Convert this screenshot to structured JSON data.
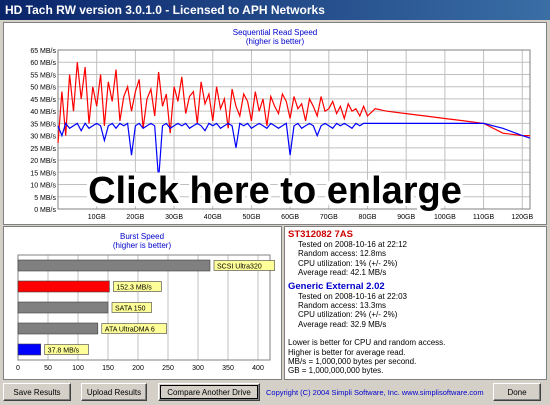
{
  "window": {
    "title": "HD Tach RW version 3.0.1.0 - Licensed to APH Networks"
  },
  "overlay_text": "Click here to enlarge",
  "colors": {
    "drive1": "#ff0000",
    "drive2": "#0000ff",
    "panel": "#d4d0c8"
  },
  "chart_data": [
    {
      "type": "line",
      "title": "Sequential Read Speed",
      "subtitle": "(higher is better)",
      "ylabel": "MB/s",
      "ylim": [
        0,
        65
      ],
      "y_ticks": [
        "0 MB/s",
        "5 MB/s",
        "10 MB/s",
        "15 MB/s",
        "20 MB/s",
        "25 MB/s",
        "30 MB/s",
        "35 MB/s",
        "40 MB/s",
        "45 MB/s",
        "50 MB/s",
        "55 MB/s",
        "60 MB/s",
        "65 MB/s"
      ],
      "xlim": [
        0,
        122
      ],
      "x_ticks": [
        "10GB",
        "20GB",
        "30GB",
        "40GB",
        "50GB",
        "60GB",
        "70GB",
        "80GB",
        "90GB",
        "100GB",
        "110GB",
        "120GB"
      ],
      "grid": true,
      "series": [
        {
          "name": "ST312082 7AS",
          "x": [
            0,
            1,
            2,
            3,
            4,
            5,
            6,
            7,
            8,
            9,
            10,
            11,
            12,
            13,
            14,
            15,
            16,
            17,
            18,
            19,
            20,
            21,
            22,
            23,
            24,
            25,
            26,
            27,
            28,
            29,
            30,
            31,
            32,
            33,
            34,
            35,
            36,
            37,
            38,
            39,
            40,
            41,
            42,
            43,
            44,
            45,
            46,
            47,
            48,
            49,
            50,
            51,
            52,
            53,
            54,
            55,
            56,
            57,
            58,
            59,
            60,
            61,
            62,
            63,
            64,
            65,
            66,
            67,
            68,
            69,
            70,
            71,
            72,
            73,
            74,
            75,
            76,
            77,
            78,
            79,
            80,
            82,
            85,
            90,
            95,
            100,
            105,
            110,
            115,
            120,
            122
          ],
          "values": [
            27,
            48,
            30,
            55,
            40,
            60,
            45,
            58,
            35,
            50,
            42,
            55,
            34,
            52,
            44,
            57,
            36,
            46,
            50,
            40,
            48,
            53,
            33,
            45,
            49,
            38,
            56,
            42,
            47,
            31,
            50,
            44,
            54,
            39,
            46,
            48,
            35,
            52,
            43,
            47,
            36,
            50,
            41,
            45,
            33,
            49,
            42,
            38,
            47,
            44,
            36,
            48,
            40,
            45,
            34,
            46,
            42,
            39,
            47,
            44,
            37,
            46,
            41,
            43,
            36,
            45,
            42,
            38,
            46,
            40,
            41,
            44,
            39,
            42,
            37,
            43,
            40,
            41,
            38,
            42,
            38,
            41,
            40,
            39,
            38,
            37,
            36,
            35,
            31,
            30,
            30
          ]
        },
        {
          "name": "Generic External 2.02",
          "x": [
            0,
            1,
            2,
            3,
            4,
            5,
            6,
            7,
            8,
            9,
            10,
            11,
            12,
            13,
            14,
            15,
            16,
            17,
            18,
            19,
            20,
            21,
            22,
            23,
            24,
            25,
            26,
            27,
            28,
            29,
            30,
            31,
            32,
            33,
            34,
            35,
            36,
            37,
            38,
            39,
            40,
            41,
            42,
            43,
            44,
            45,
            46,
            47,
            48,
            49,
            50,
            51,
            52,
            53,
            54,
            55,
            56,
            57,
            58,
            59,
            60,
            61,
            62,
            63,
            64,
            65,
            66,
            67,
            68,
            69,
            70,
            71,
            72,
            73,
            74,
            75,
            76,
            77,
            78,
            79,
            80,
            85,
            90,
            100,
            110,
            115,
            120,
            122
          ],
          "values": [
            34,
            30,
            35,
            33,
            34,
            35,
            32,
            35,
            33,
            34,
            35,
            34,
            28,
            34,
            35,
            33,
            35,
            34,
            35,
            22,
            34,
            35,
            33,
            34,
            35,
            34,
            12,
            34,
            35,
            33,
            34,
            35,
            34,
            35,
            33,
            34,
            35,
            34,
            32,
            35,
            34,
            35,
            33,
            34,
            35,
            34,
            25,
            35,
            34,
            35,
            33,
            34,
            35,
            34,
            33,
            35,
            34,
            33,
            34,
            35,
            22,
            34,
            35,
            33,
            34,
            35,
            34,
            30,
            34,
            35,
            34,
            33,
            35,
            34,
            35,
            34,
            33,
            35,
            34,
            35,
            35,
            35,
            35,
            35,
            35,
            33,
            30,
            29
          ]
        }
      ]
    },
    {
      "type": "bar",
      "title": "Burst Speed",
      "subtitle": "(higher is better)",
      "x_ticks": [
        "0",
        "50",
        "100",
        "150",
        "200",
        "250",
        "300",
        "350",
        "400"
      ],
      "xlim": [
        0,
        420
      ],
      "categories": [
        "SCSI Ultra320",
        "152.3 MB/s",
        "SATA 150",
        "ATA UltraDMA 6",
        "37.8 MB/s"
      ],
      "values": [
        320,
        152.3,
        150,
        133,
        37.8
      ],
      "bar_colors": [
        "#808080",
        "#ff0000",
        "#808080",
        "#808080",
        "#0000ff"
      ]
    }
  ],
  "results": {
    "drive1": {
      "name": "ST312082 7AS",
      "tested": "Tested on 2008-10-16 at 22:12",
      "access": "Random access: 12.8ms",
      "cpu": "CPU utilization: 1% (+/- 2%)",
      "avg": "Average read: 42.1 MB/s"
    },
    "drive2": {
      "name": "Generic External 2.02",
      "tested": "Tested on 2008-10-16 at 22:03",
      "access": "Random access: 13.3ms",
      "cpu": "CPU utilization: 2% (+/- 2%)",
      "avg": "Average read: 32.9 MB/s"
    },
    "notes": [
      "Lower is better for CPU and random access.",
      "Higher is better for average read.",
      "MB/s = 1,000,000 bytes per second.",
      "GB = 1,000,000,000 bytes."
    ]
  },
  "buttons": {
    "save": "Save Results",
    "upload": "Upload Results",
    "compare": "Compare Another Drive",
    "done": "Done"
  },
  "copyright": "Copyright (C) 2004 Simpli Software, Inc. www.simplisoftware.com"
}
